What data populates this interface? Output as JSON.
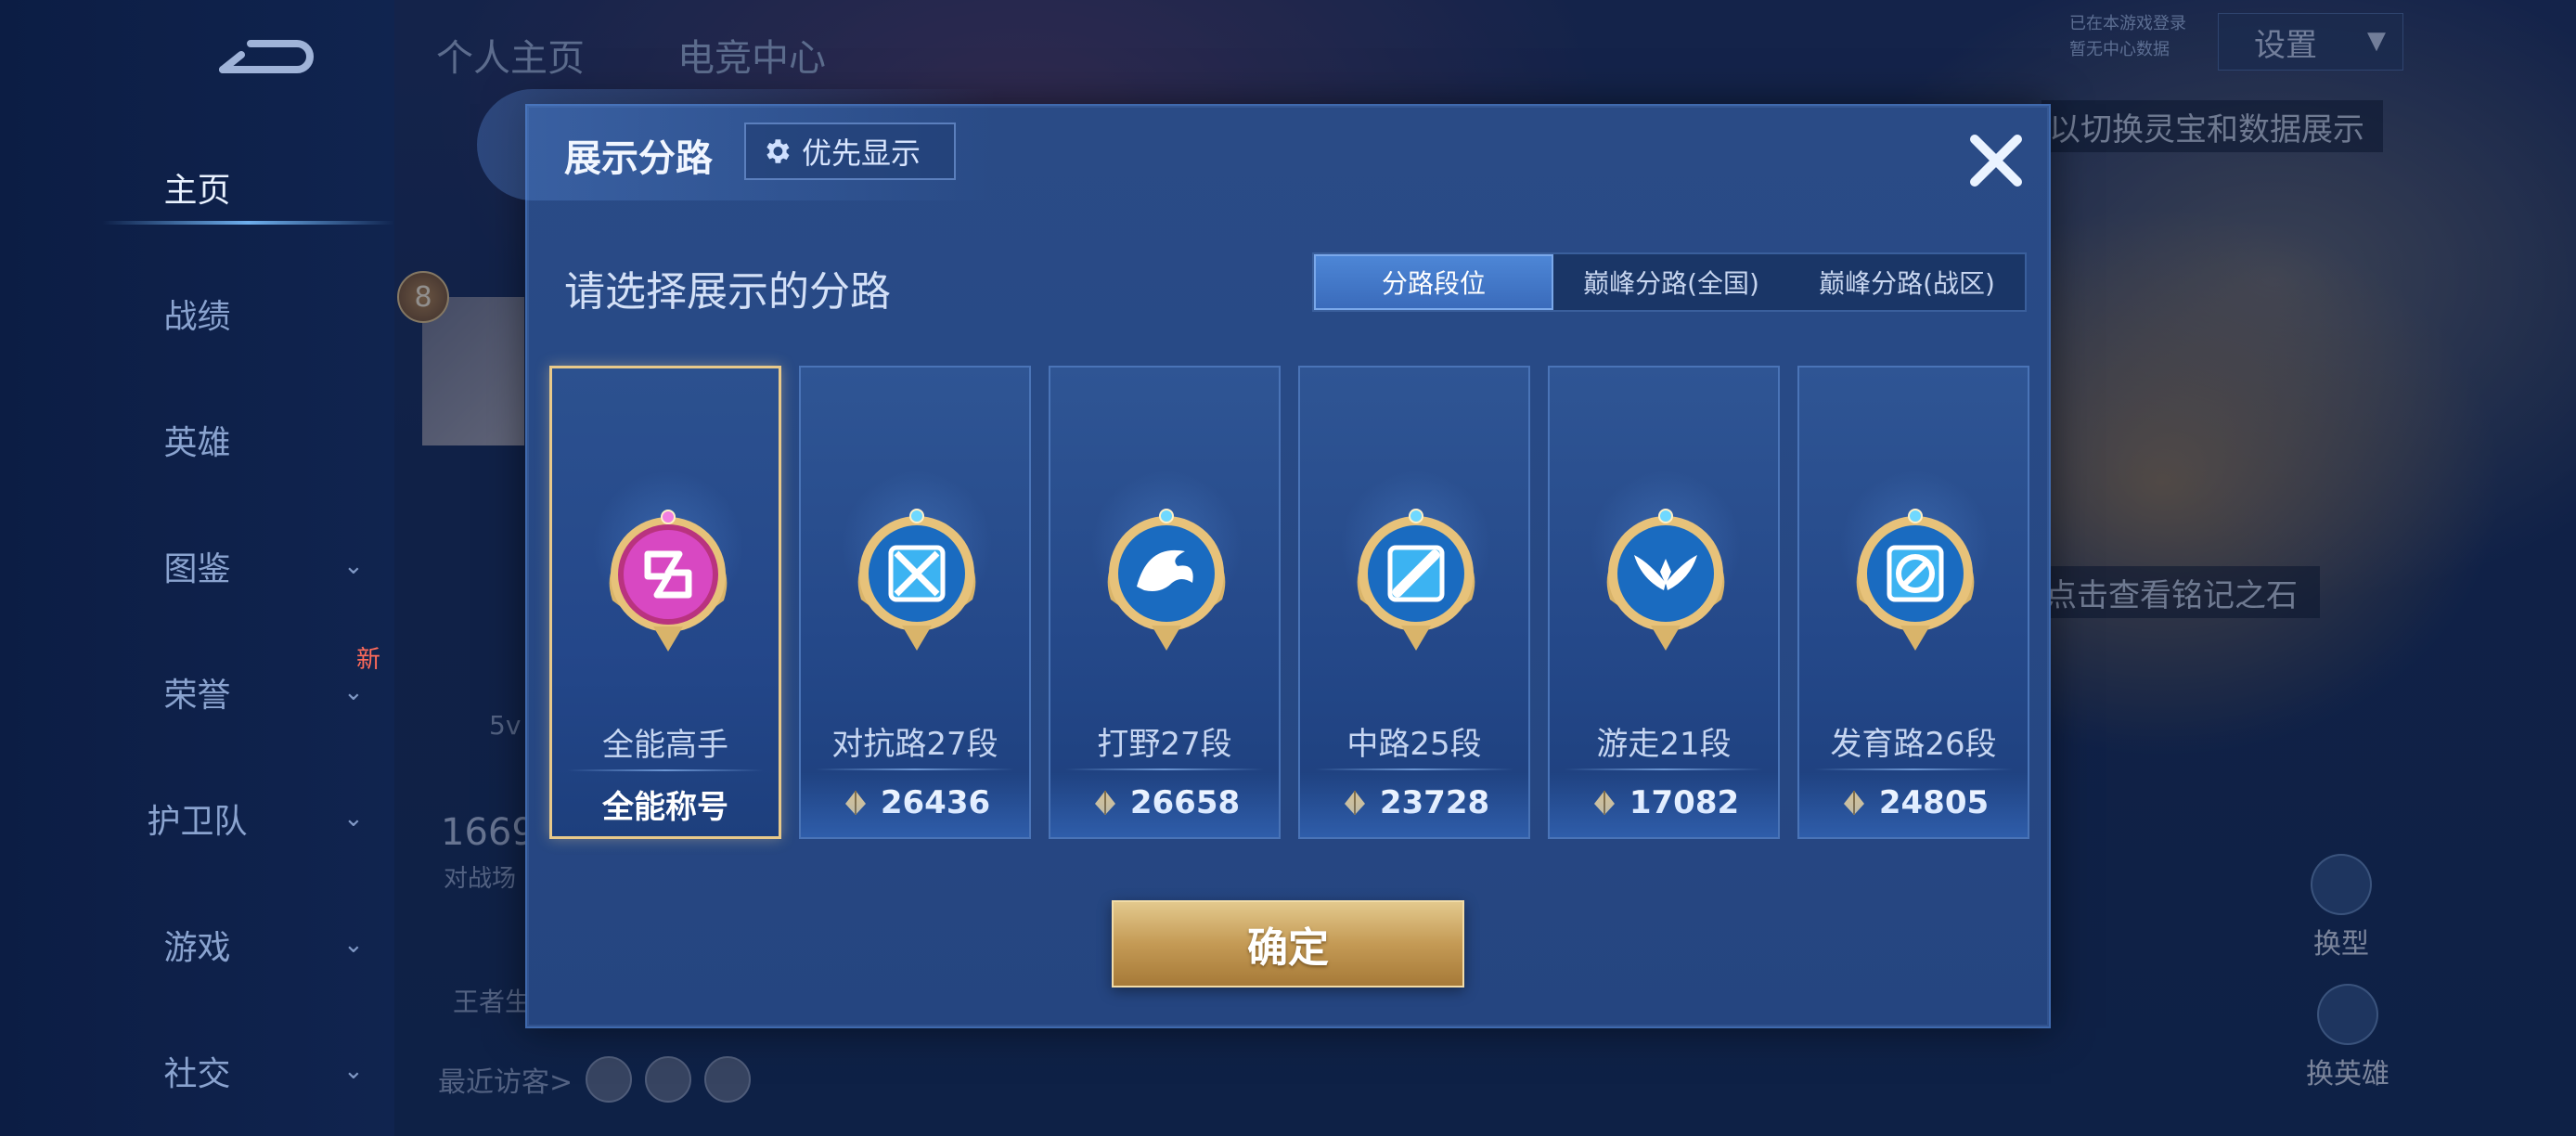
{
  "sidebar": {
    "items": [
      {
        "label": "主页",
        "chevron": false,
        "active": true
      },
      {
        "label": "战绩",
        "chevron": false,
        "active": false
      },
      {
        "label": "英雄",
        "chevron": false,
        "active": false
      },
      {
        "label": "图鉴",
        "chevron": true,
        "active": false
      },
      {
        "label": "荣誉",
        "chevron": true,
        "active": false
      },
      {
        "label": "护卫队",
        "chevron": true,
        "active": false
      },
      {
        "label": "游戏",
        "chevron": true,
        "active": false
      },
      {
        "label": "社交",
        "chevron": true,
        "active": false
      }
    ],
    "new_badge": "新"
  },
  "header": {
    "tabs": [
      "个人主页",
      "电竞中心"
    ],
    "settings_label": "设置",
    "status_line1": "已在本游戏登录",
    "status_line2": "暂无中心数据"
  },
  "background": {
    "hint_top": "以切换灵宝和数据展示",
    "hint_mid": "点击查看铭记之石",
    "switch_model_label": "换型",
    "switch_hero_label": "换英雄",
    "level": "8",
    "mode_label": "5v",
    "stat_value": "1669",
    "stat_caption": "对战场",
    "king_label": "王者生",
    "visitors_label": "最近访客>"
  },
  "dialog": {
    "title": "展示分路",
    "priority_button": "优先显示",
    "prompt": "请选择展示的分路",
    "segments": [
      {
        "label": "分路段位",
        "active": true
      },
      {
        "label": "巅峰分路(全国)",
        "active": false
      },
      {
        "label": "巅峰分路(战区)",
        "active": false
      }
    ],
    "cards": [
      {
        "name": "全能高手",
        "value": "全能称号",
        "is_title": true,
        "selected": true,
        "emblem": "all-round-emblem-icon",
        "color": "#c83fbf"
      },
      {
        "name": "对抗路27段",
        "value": "26436",
        "is_title": false,
        "selected": false,
        "emblem": "clash-lane-emblem-icon",
        "color": "#2a8fe0"
      },
      {
        "name": "打野27段",
        "value": "26658",
        "is_title": false,
        "selected": false,
        "emblem": "jungle-emblem-icon",
        "color": "#2a8fe0"
      },
      {
        "name": "中路25段",
        "value": "23728",
        "is_title": false,
        "selected": false,
        "emblem": "mid-lane-emblem-icon",
        "color": "#2a8fe0"
      },
      {
        "name": "游走21段",
        "value": "17082",
        "is_title": false,
        "selected": false,
        "emblem": "roam-emblem-icon",
        "color": "#2a8fe0"
      },
      {
        "name": "发育路26段",
        "value": "24805",
        "is_title": false,
        "selected": false,
        "emblem": "farm-lane-emblem-icon",
        "color": "#2a8fe0"
      }
    ],
    "confirm_label": "确定"
  },
  "colors": {
    "accent_gold": "#e8c98a",
    "button_gold": "#c49a55",
    "segment_active": "#3f74c6",
    "panel": "#284a86"
  }
}
